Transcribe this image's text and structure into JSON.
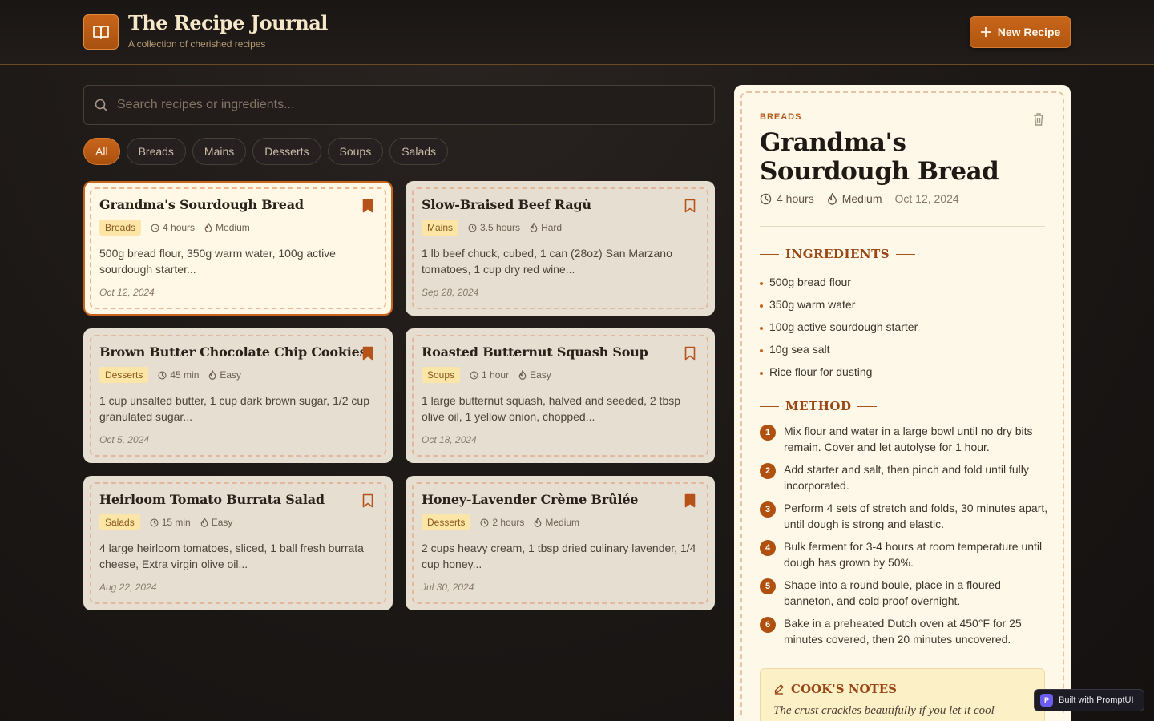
{
  "app": {
    "title": "The Recipe Journal",
    "subtitle": "A collection of cherished recipes",
    "new_recipe_label": "New Recipe",
    "logo_icon": "open-book-icon"
  },
  "search": {
    "placeholder": "Search recipes or ingredients...",
    "value": ""
  },
  "filters": [
    "All",
    "Breads",
    "Mains",
    "Desserts",
    "Soups",
    "Salads"
  ],
  "active_filter": "All",
  "recipes": [
    {
      "title": "Grandma's Sourdough Bread",
      "category": "Breads",
      "time": "4 hours",
      "difficulty": "Medium",
      "snippet": "500g bread flour, 350g warm water, 100g active sourdough starter...",
      "date": "Oct 12, 2024",
      "bookmarked": true,
      "selected": true
    },
    {
      "title": "Slow-Braised Beef Ragù",
      "category": "Mains",
      "time": "3.5 hours",
      "difficulty": "Hard",
      "snippet": "1 lb beef chuck, cubed, 1 can (28oz) San Marzano tomatoes, 1 cup dry red wine...",
      "date": "Sep 28, 2024",
      "bookmarked": false,
      "selected": false
    },
    {
      "title": "Brown Butter Chocolate Chip Cookies",
      "category": "Desserts",
      "time": "45 min",
      "difficulty": "Easy",
      "snippet": "1 cup unsalted butter, 1 cup dark brown sugar, 1/2 cup granulated sugar...",
      "date": "Oct 5, 2024",
      "bookmarked": true,
      "selected": false
    },
    {
      "title": "Roasted Butternut Squash Soup",
      "category": "Soups",
      "time": "1 hour",
      "difficulty": "Easy",
      "snippet": "1 large butternut squash, halved and seeded, 2 tbsp olive oil, 1 yellow onion, chopped...",
      "date": "Oct 18, 2024",
      "bookmarked": false,
      "selected": false
    },
    {
      "title": "Heirloom Tomato Burrata Salad",
      "category": "Salads",
      "time": "15 min",
      "difficulty": "Easy",
      "snippet": "4 large heirloom tomatoes, sliced, 1 ball fresh burrata cheese, Extra virgin olive oil...",
      "date": "Aug 22, 2024",
      "bookmarked": false,
      "selected": false
    },
    {
      "title": "Honey-Lavender Crème Brûlée",
      "category": "Desserts",
      "time": "2 hours",
      "difficulty": "Medium",
      "snippet": "2 cups heavy cream, 1 tbsp dried culinary lavender, 1/4 cup honey...",
      "date": "Jul 30, 2024",
      "bookmarked": true,
      "selected": false
    }
  ],
  "detail": {
    "category": "BREADS",
    "title": "Grandma's Sourdough Bread",
    "time": "4 hours",
    "difficulty": "Medium",
    "date": "Oct 12, 2024",
    "ingredients_heading": "INGREDIENTS",
    "ingredients": [
      "500g bread flour",
      "350g warm water",
      "100g active sourdough starter",
      "10g sea salt",
      "Rice flour for dusting"
    ],
    "method_heading": "METHOD",
    "steps": [
      "Mix flour and water in a large bowl until no dry bits remain. Cover and let autolyse for 1 hour.",
      "Add starter and salt, then pinch and fold until fully incorporated.",
      "Perform 4 sets of stretch and folds, 30 minutes apart, until dough is strong and elastic.",
      "Bulk ferment for 3-4 hours at room temperature until dough has grown by 50%.",
      "Shape into a round boule, place in a floured banneton, and cold proof overnight.",
      "Bake in a preheated Dutch oven at 450°F for 25 minutes covered, then 20 minutes uncovered."
    ],
    "notes_heading": "COOK'S NOTES",
    "notes_text": "The crust crackles beautifully if you let it cool"
  },
  "badge": {
    "label": "Built with PromptUI",
    "letter": "P"
  },
  "colors": {
    "accent": "#c8651b",
    "bookmark": "#b5531a",
    "tag_bg": "#fbe6a8"
  }
}
